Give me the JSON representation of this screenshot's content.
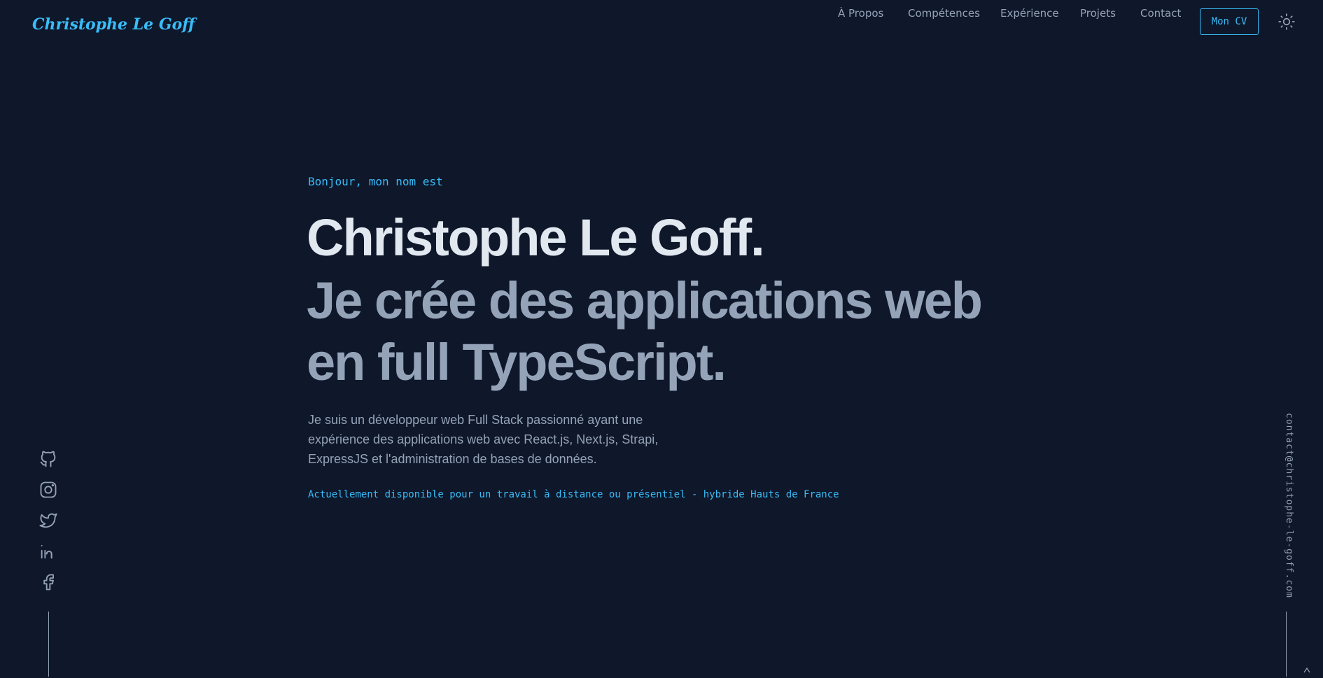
{
  "header": {
    "logo": "Christophe Le Goff",
    "nav": [
      "À Propos",
      "Compétences",
      "Expérience",
      "Projets",
      "Contact"
    ],
    "cv_label": "Mon CV",
    "theme_icon": "sun-icon"
  },
  "hero": {
    "intro": "Bonjour, mon nom est",
    "name": "Christophe Le Goff.",
    "tagline": "Je crée des applications web en full TypeScript.",
    "description": "Je suis un développeur web Full Stack passionné ayant une expérience des applications web avec React.js, Next.js, Strapi, ExpressJS et l'administration de bases de données.",
    "availability": "Actuellement disponible pour un travail à distance ou présentiel - hybride Hauts de France"
  },
  "social": {
    "icons": [
      "github-icon",
      "instagram-icon",
      "twitter-icon",
      "linkedin-icon",
      "facebook-icon"
    ]
  },
  "contact": {
    "email": "contact@christophe-le-goff.com"
  },
  "colors": {
    "background": "#0f172a",
    "accent": "#38bdf8",
    "heading": "#e2e8f0",
    "text": "#94a3b8"
  }
}
